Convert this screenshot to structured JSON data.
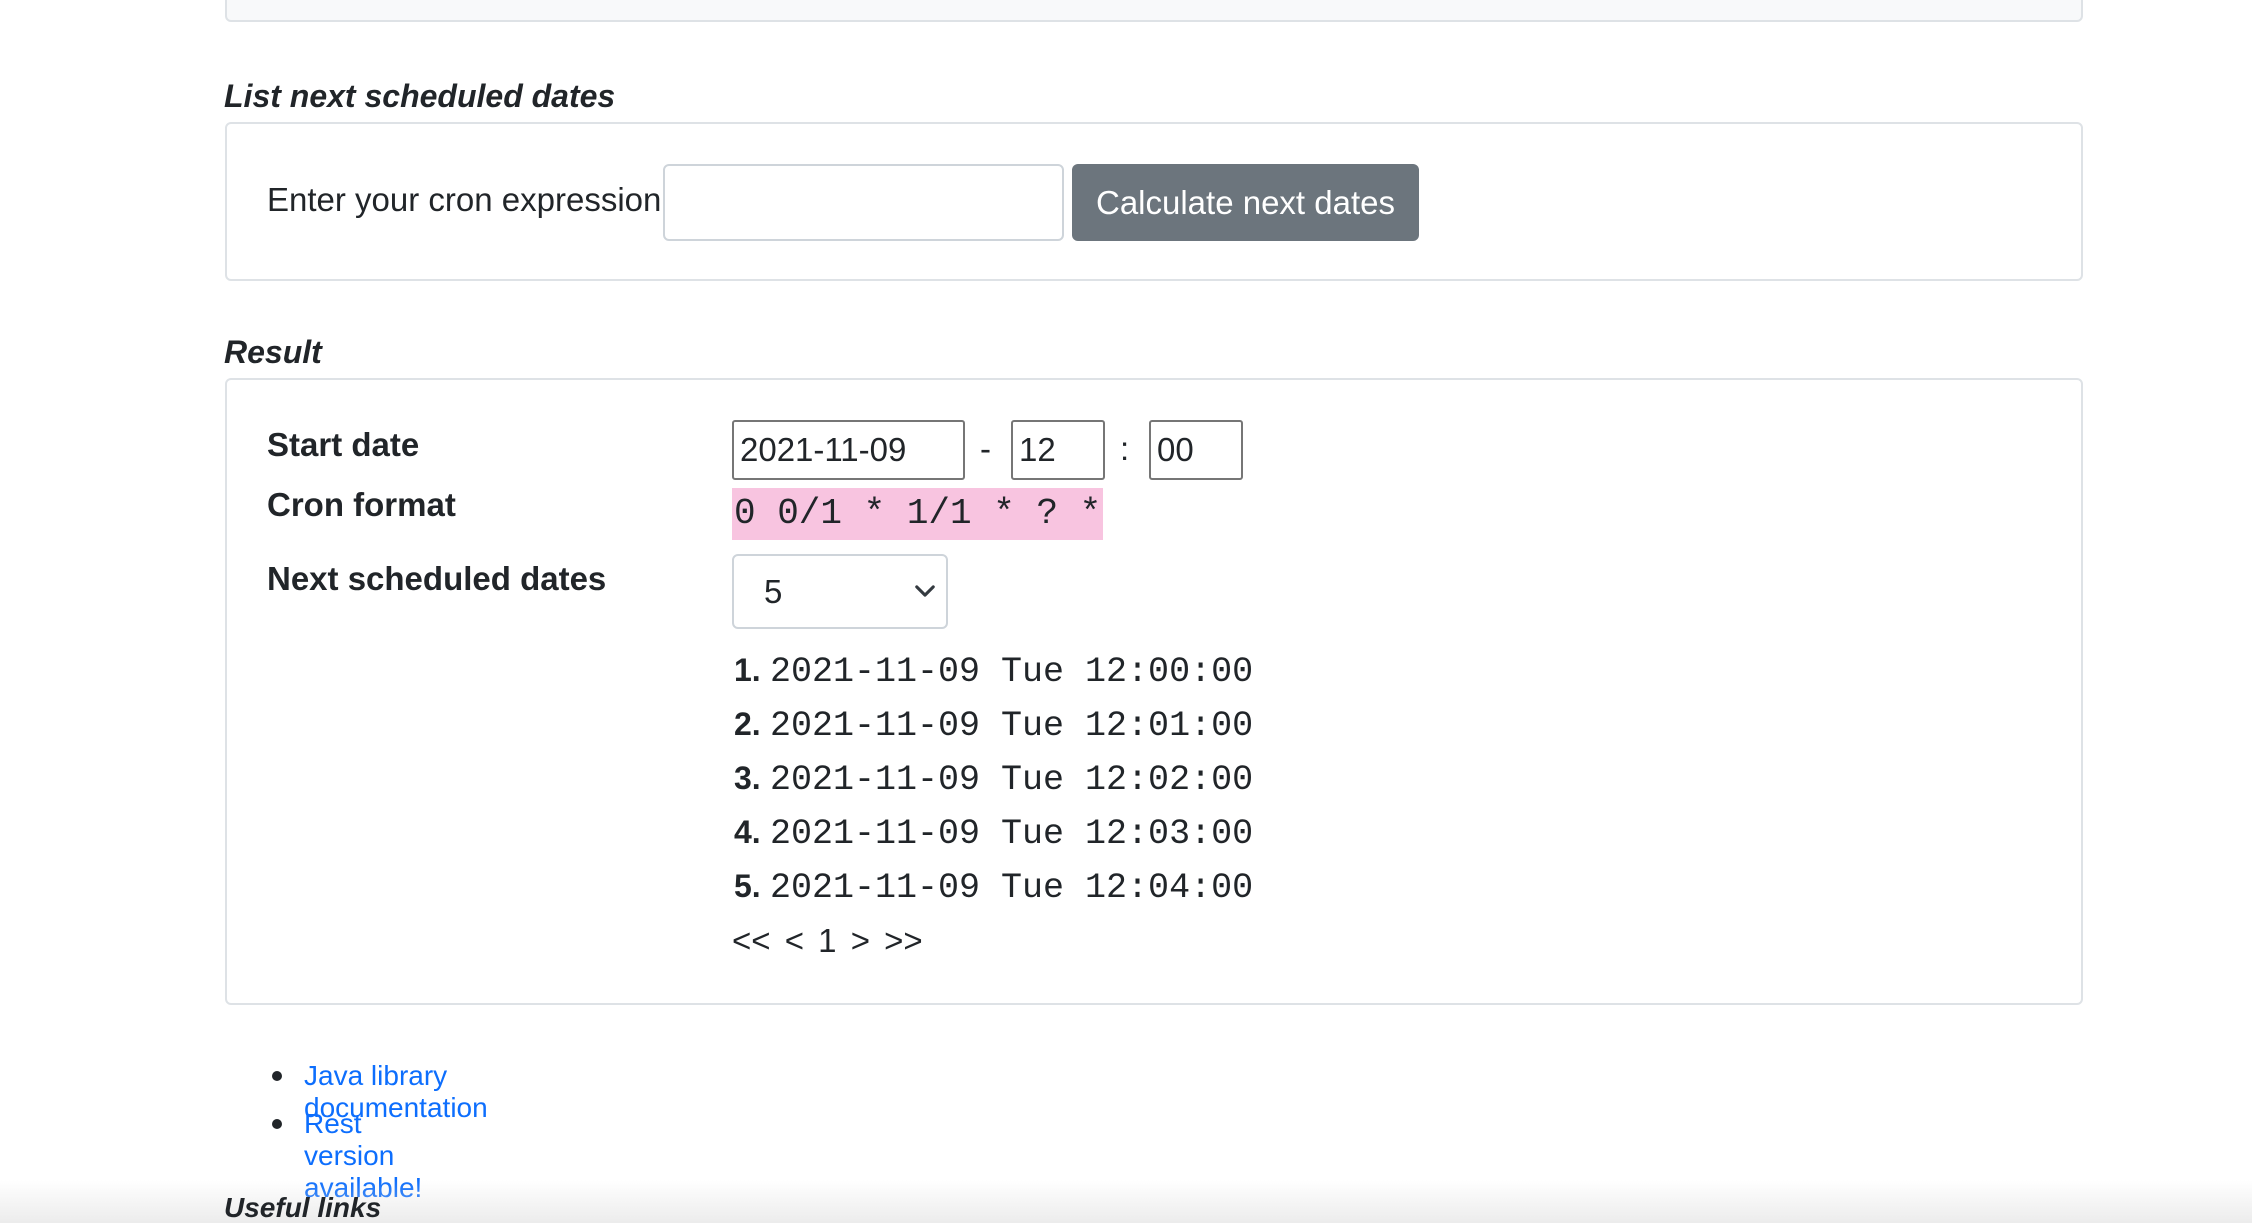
{
  "sections": {
    "list_title": "List next scheduled dates",
    "result_title": "Result",
    "useful_links_title": "Useful links"
  },
  "cron_form": {
    "label": "Enter your cron expression",
    "input_value": "",
    "button_label": "Calculate next dates"
  },
  "result": {
    "start_date_label": "Start date",
    "date_value": "2021-11-09",
    "hour_value": "12",
    "minute_value": "00",
    "dash": "-",
    "colon": ":",
    "cron_format_label": "Cron format",
    "cron_format_value": "0 0/1 * 1/1 * ? *",
    "next_dates_label": "Next scheduled dates",
    "count_selected": "5",
    "dates": [
      {
        "num": "1.",
        "text": "2021-11-09 Tue 12:00:00"
      },
      {
        "num": "2.",
        "text": "2021-11-09 Tue 12:01:00"
      },
      {
        "num": "3.",
        "text": "2021-11-09 Tue 12:02:00"
      },
      {
        "num": "4.",
        "text": "2021-11-09 Tue 12:03:00"
      },
      {
        "num": "5.",
        "text": "2021-11-09 Tue 12:04:00"
      }
    ],
    "pager": {
      "first": "<<",
      "prev": "<",
      "page": "1",
      "next": ">",
      "last": ">>"
    }
  },
  "links": [
    {
      "label": "Java library documentation"
    },
    {
      "label": "Rest version available!"
    }
  ],
  "icons": {
    "select": "chevron-down-icon"
  },
  "colors": {
    "button_bg": "#6c757d",
    "link": "#0d6efd",
    "cron_highlight": "#f8c4e0"
  }
}
